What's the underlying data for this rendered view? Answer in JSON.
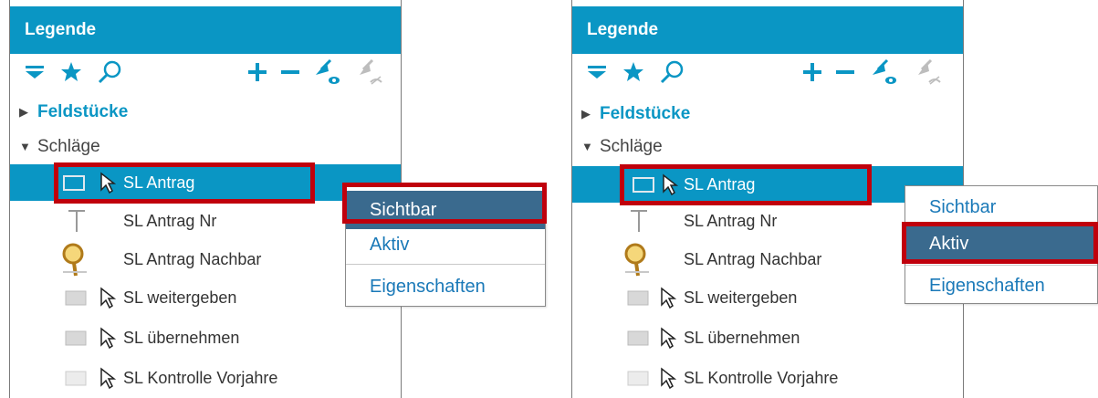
{
  "colors": {
    "header": "#0a96c4",
    "selection": "#0a96c4",
    "highlight": "#3a6a8e",
    "callout": "#c0000c",
    "link": "#1a79b8"
  },
  "panels": [
    {
      "title": "Legende",
      "toolbar_icons": [
        "filter-icon",
        "star-icon",
        "search-icon",
        "plus-icon",
        "minus-icon",
        "visible-arrow-icon",
        "hidden-arrow-icon"
      ],
      "groups": [
        {
          "label": "Feldstücke",
          "expanded": false
        },
        {
          "label": "Schläge",
          "expanded": true
        }
      ],
      "items": [
        {
          "label": "SL Antrag",
          "selected": true
        },
        {
          "label": "SL Antrag Nr"
        },
        {
          "label": "SL Antrag Nachbar"
        },
        {
          "label": "SL weitergeben"
        },
        {
          "label": "SL übernehmen"
        },
        {
          "label": "SL Kontrolle Vorjahre"
        }
      ],
      "context_menu": {
        "items": [
          "Sichtbar",
          "Aktiv",
          "Eigenschaften"
        ],
        "highlighted": "Sichtbar"
      }
    },
    {
      "title": "Legende",
      "toolbar_icons": [
        "filter-icon",
        "star-icon",
        "search-icon",
        "plus-icon",
        "minus-icon",
        "visible-arrow-icon",
        "hidden-arrow-icon"
      ],
      "groups": [
        {
          "label": "Feldstücke",
          "expanded": false
        },
        {
          "label": "Schläge",
          "expanded": true
        }
      ],
      "items": [
        {
          "label": "SL Antrag",
          "selected": true
        },
        {
          "label": "SL Antrag Nr"
        },
        {
          "label": "SL Antrag Nachbar"
        },
        {
          "label": "SL weitergeben"
        },
        {
          "label": "SL übernehmen"
        },
        {
          "label": "SL Kontrolle Vorjahre"
        }
      ],
      "context_menu": {
        "items": [
          "Sichtbar",
          "Aktiv",
          "Eigenschaften"
        ],
        "highlighted": "Aktiv"
      }
    }
  ]
}
